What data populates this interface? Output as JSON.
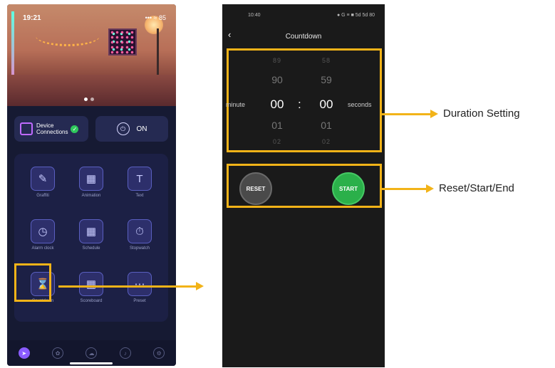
{
  "home_screen": {
    "status_time": "19:21",
    "status_icons": "••• ≈ 85",
    "device_connections_label": "Device\nConnections",
    "power_label": "ON",
    "tiles": [
      {
        "label": "Graffiti",
        "icon": "brush-icon"
      },
      {
        "label": "Animation",
        "icon": "animation-icon"
      },
      {
        "label": "Text",
        "icon": "text-icon"
      },
      {
        "label": "Alarm clock",
        "icon": "alarm-clock-icon"
      },
      {
        "label": "Schedule",
        "icon": "calendar-icon"
      },
      {
        "label": "Stopwatch",
        "icon": "stopwatch-icon"
      },
      {
        "label": "Countdown",
        "icon": "hourglass-icon"
      },
      {
        "label": "Scoreboard",
        "icon": "scoreboard-icon"
      },
      {
        "label": "Preset",
        "icon": "preset-icon"
      }
    ],
    "nav_icons": [
      "compass-icon",
      "palette-icon",
      "cloud-icon",
      "music-icon",
      "settings-icon"
    ]
  },
  "countdown_screen": {
    "status_time": "10:40",
    "status_icons": "● G ≡ ■ 5d 5d 80",
    "title": "Countdown",
    "minutes": {
      "r1": "89",
      "r2": "90",
      "selected": "00",
      "r4": "01",
      "r5": "02"
    },
    "seconds": {
      "r1": "58",
      "r2": "59",
      "selected": "00",
      "r4": "01",
      "r5": "02"
    },
    "minute_label": "minute",
    "seconds_label": "seconds",
    "separator": ":",
    "reset_label": "RESET",
    "start_label": "START"
  },
  "callouts": {
    "duration": "Duration Setting",
    "buttons": "Reset/Start/End"
  },
  "colors": {
    "highlight": "#f2b318",
    "start_green": "#2bb04a"
  }
}
